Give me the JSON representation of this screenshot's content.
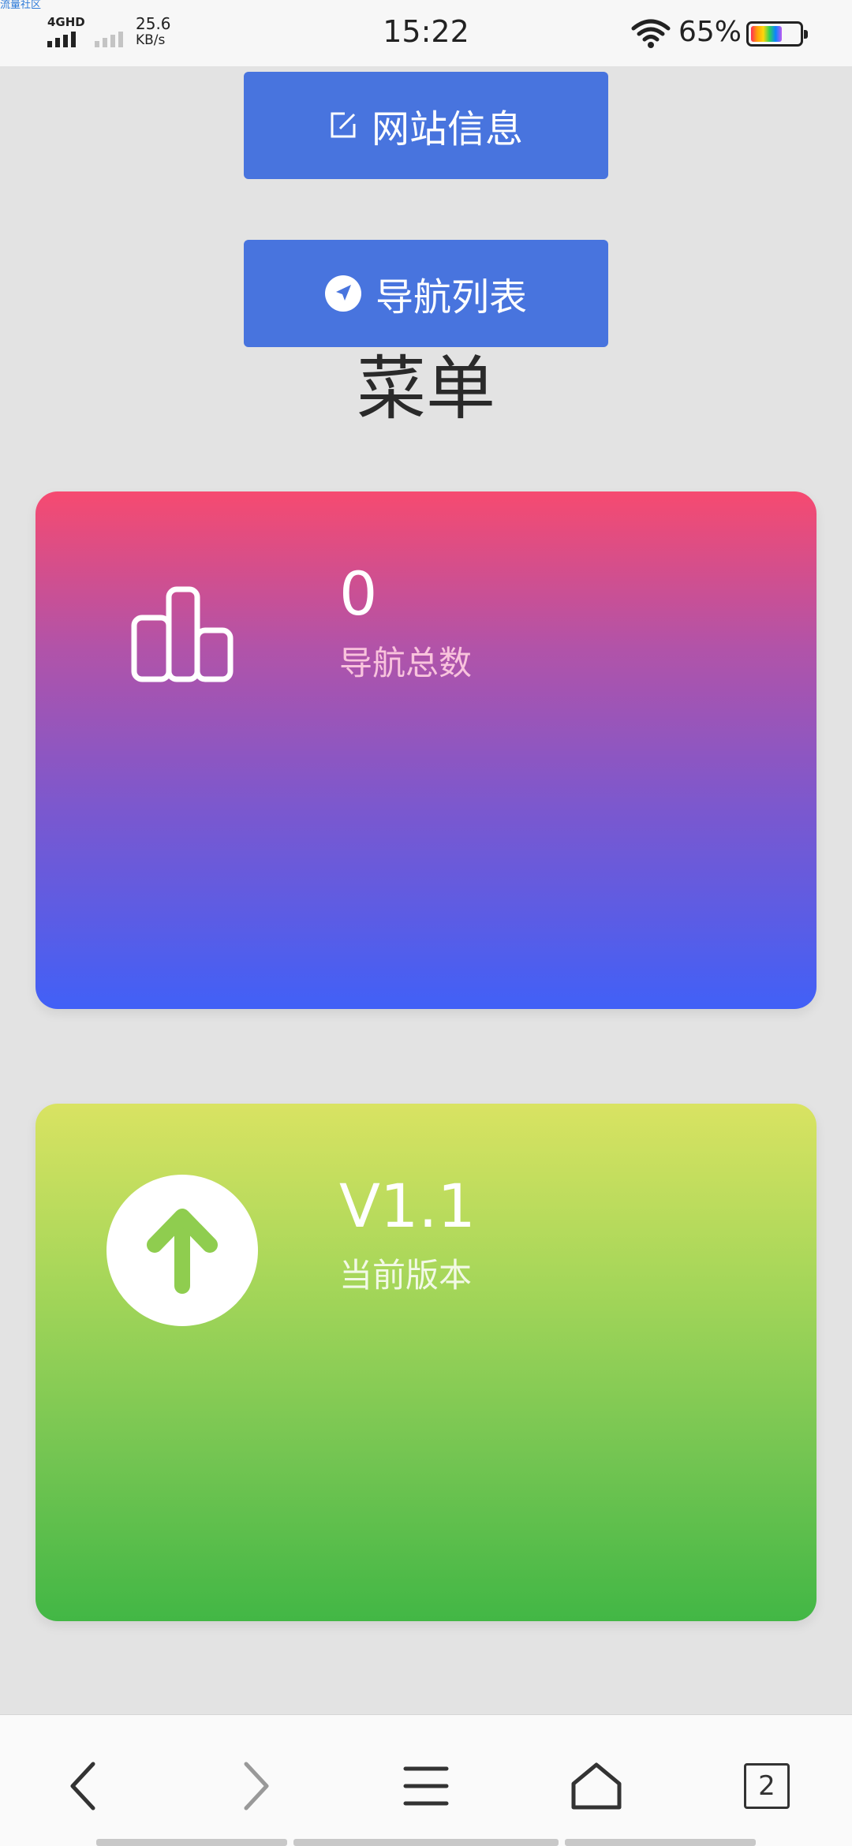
{
  "status_bar": {
    "watermark": "流量社区",
    "network": "4GHD",
    "speed_value": "25.6",
    "speed_unit": "KB/s",
    "time": "15:22",
    "battery_percent": "65%",
    "battery_level": 0.65
  },
  "actions": {
    "site_info_label": "网站信息",
    "nav_list_label": "导航列表"
  },
  "menu": {
    "title": "菜单"
  },
  "cards": {
    "nav_total": {
      "value": "0",
      "label": "导航总数",
      "icon": "bar-chart-icon"
    },
    "version": {
      "value": "V1.1",
      "label": "当前版本",
      "icon": "arrow-up-icon"
    }
  },
  "bottom_bar": {
    "tab_count": "2",
    "icons": [
      "back-icon",
      "forward-icon",
      "menu-icon",
      "home-icon",
      "tabs-icon"
    ]
  },
  "colors": {
    "button_blue": "#4874de",
    "card_nav_top": "#f64a70",
    "card_nav_bottom": "#4160f7",
    "card_version_top": "#d9e362",
    "card_version_bottom": "#42b745"
  }
}
